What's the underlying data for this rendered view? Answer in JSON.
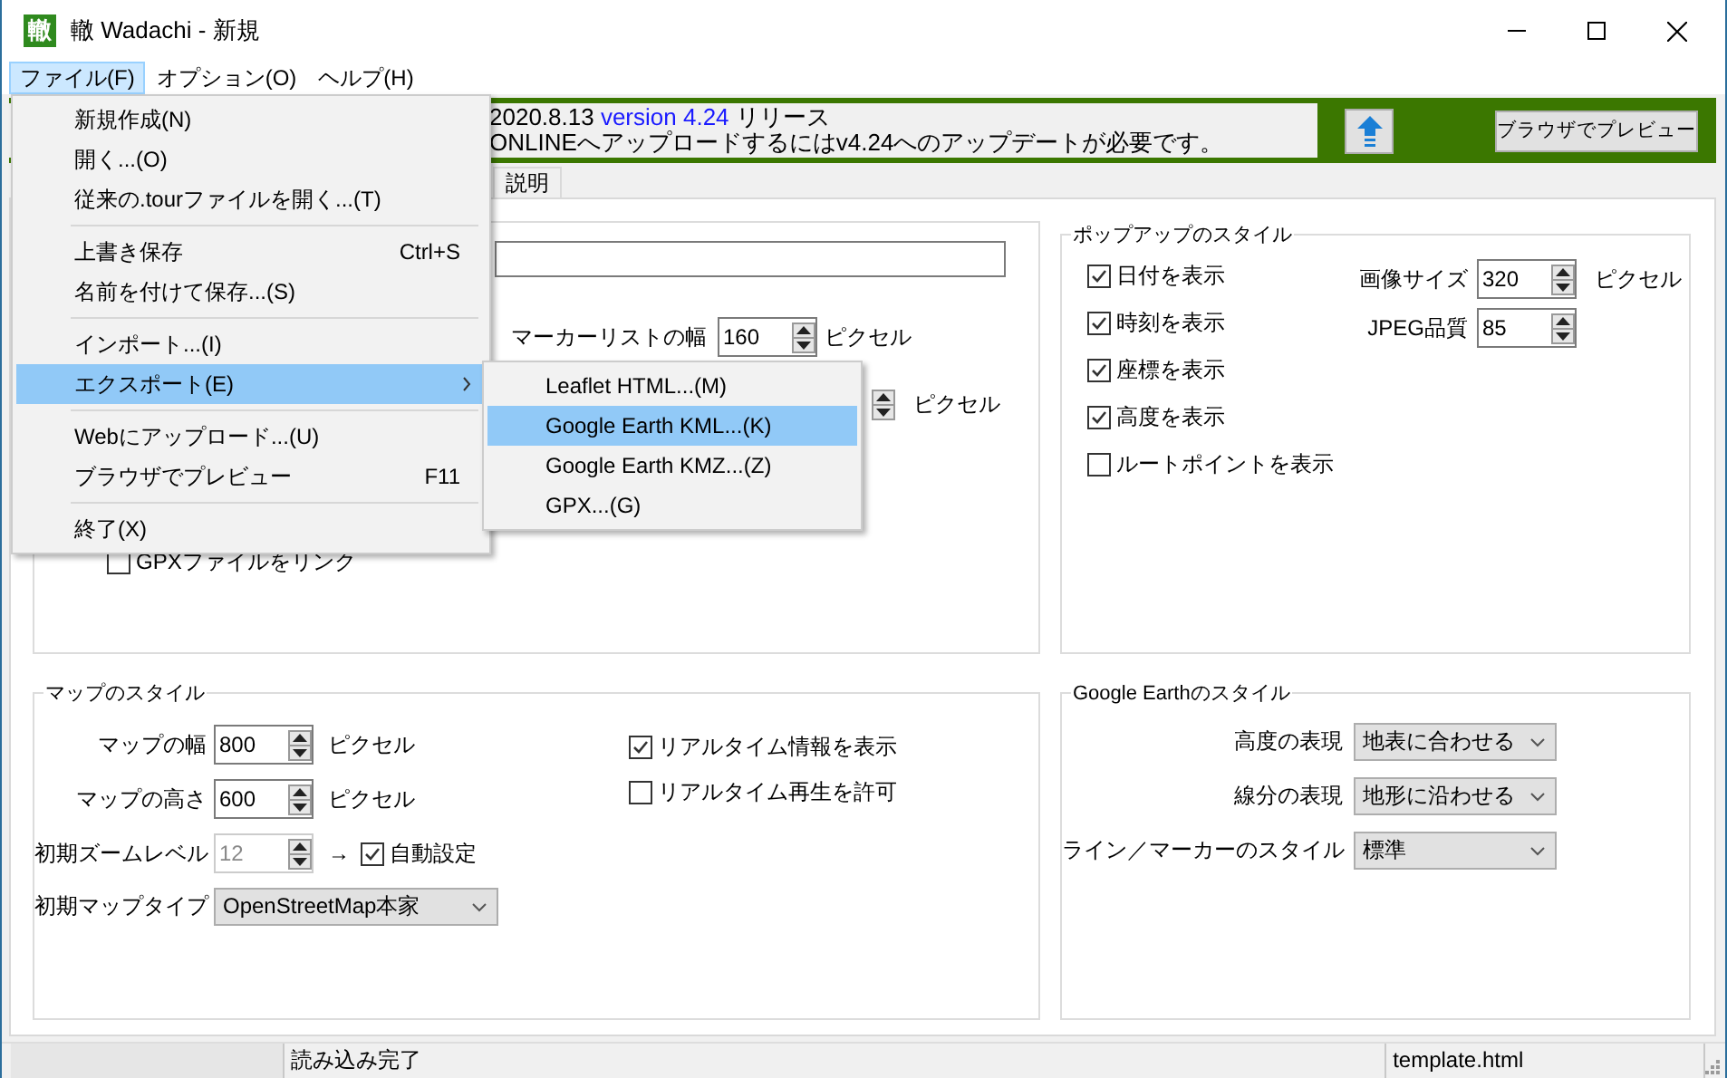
{
  "window": {
    "icon_glyph": "轍",
    "title": "轍 Wadachi - 新規"
  },
  "menu_bar": [
    {
      "label": "ファイル(F)",
      "selected": true
    },
    {
      "label": "オプション(O)",
      "selected": false
    },
    {
      "label": "ヘルプ(H)",
      "selected": false
    }
  ],
  "banner": {
    "release_date": "2020.8.13",
    "release_link": "version 4.24",
    "release_suffix": "リリース",
    "notice": "ONLINEへアップロードするにはv4.24へのアップデートが必要です。",
    "preview_button": "ブラウザでプレビュー"
  },
  "tabs": [
    {
      "label": "説明",
      "selected": false
    }
  ],
  "general": {
    "rows": [
      {
        "kind": "text_field"
      },
      {
        "kind": "spin",
        "label": "マーカーリストの幅",
        "value": "160",
        "unit": "ピクセル"
      },
      {
        "kind": "spin_covered",
        "unit": "ピクセル"
      },
      {
        "kind": "check",
        "label": "GPXファイルをリンク",
        "checked": false
      }
    ]
  },
  "popup_style": {
    "title": "ポップアップのスタイル",
    "checks": [
      {
        "label": "日付を表示",
        "checked": true
      },
      {
        "label": "時刻を表示",
        "checked": true
      },
      {
        "label": "座標を表示",
        "checked": true
      },
      {
        "label": "高度を表示",
        "checked": true
      },
      {
        "label": "ルートポイントを表示",
        "checked": false
      }
    ],
    "spins": [
      {
        "label": "画像サイズ",
        "value": "320",
        "unit": "ピクセル"
      },
      {
        "label": "JPEG品質",
        "value": "85"
      }
    ]
  },
  "map_style": {
    "title": "マップのスタイル",
    "spins": [
      {
        "label": "マップの幅",
        "value": "800",
        "unit": "ピクセル",
        "disabled": false
      },
      {
        "label": "マップの高さ",
        "value": "600",
        "unit": "ピクセル",
        "disabled": false
      },
      {
        "label": "初期ズームレベル",
        "value": "12",
        "disabled": true,
        "arrow": "→",
        "auto_check": {
          "label": "自動設定",
          "checked": true
        }
      }
    ],
    "map_type": {
      "label": "初期マップタイプ",
      "value": "OpenStreetMap本家"
    },
    "checks": [
      {
        "label": "リアルタイム情報を表示",
        "checked": true
      },
      {
        "label": "リアルタイム再生を許可",
        "checked": false
      }
    ]
  },
  "google_earth_style": {
    "title": "Google Earthのスタイル",
    "combos": [
      {
        "label": "高度の表現",
        "value": "地表に合わせる"
      },
      {
        "label": "線分の表現",
        "value": "地形に沿わせる"
      },
      {
        "label": "ライン／マーカーのスタイル",
        "value": "標準"
      }
    ]
  },
  "status_bar": {
    "panes": [
      "読み込み完了",
      "template.html"
    ]
  },
  "file_menu": [
    {
      "kind": "item",
      "label": "新規作成(N)",
      "selected": false
    },
    {
      "kind": "item",
      "label": "開く...(O)",
      "selected": false
    },
    {
      "kind": "item",
      "label": "従来の.tourファイルを開く...(T)",
      "selected": false
    },
    {
      "kind": "separator"
    },
    {
      "kind": "item",
      "label": "上書き保存",
      "shortcut": "Ctrl+S",
      "selected": false
    },
    {
      "kind": "item",
      "label": "名前を付けて保存...(S)",
      "selected": false
    },
    {
      "kind": "separator"
    },
    {
      "kind": "item",
      "label": "インポート...(I)",
      "selected": false
    },
    {
      "kind": "submenu",
      "label": "エクスポート(E)",
      "selected": true
    },
    {
      "kind": "separator"
    },
    {
      "kind": "item",
      "label": "Webにアップロード...(U)",
      "selected": false
    },
    {
      "kind": "item",
      "label": "ブラウザでプレビュー",
      "shortcut": "F11",
      "selected": false
    },
    {
      "kind": "separator"
    },
    {
      "kind": "item",
      "label": "終了(X)",
      "selected": false
    }
  ],
  "export_submenu": [
    {
      "label": "Leaflet HTML...(M)",
      "selected": false
    },
    {
      "label": "Google Earth KML...(K)",
      "selected": true
    },
    {
      "label": "Google Earth KMZ...(Z)",
      "selected": false
    },
    {
      "label": "GPX...(G)",
      "selected": false
    }
  ]
}
